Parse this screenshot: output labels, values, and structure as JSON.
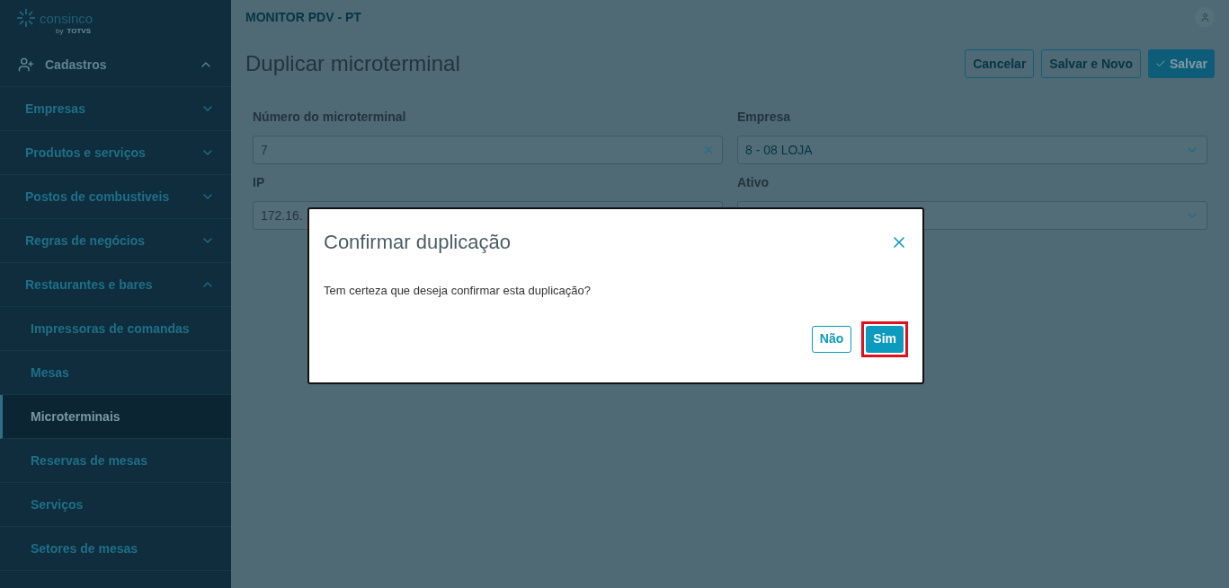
{
  "sidebar": {
    "logo": {
      "name": "consinco",
      "by": "by",
      "partner": "TOTVS"
    },
    "section": {
      "label": "Cadastros",
      "expanded": true
    },
    "items": [
      {
        "label": "Empresas",
        "expanded": false
      },
      {
        "label": "Produtos e serviços",
        "expanded": false
      },
      {
        "label": "Postos de combustiveis",
        "expanded": false
      },
      {
        "label": "Regras de negócios",
        "expanded": false
      },
      {
        "label": "Restaurantes e bares",
        "expanded": true,
        "children": [
          {
            "label": "Impressoras de comandas",
            "selected": false
          },
          {
            "label": "Mesas",
            "selected": false
          },
          {
            "label": "Microterminais",
            "selected": true
          },
          {
            "label": "Reservas de mesas",
            "selected": false
          },
          {
            "label": "Serviços",
            "selected": false
          },
          {
            "label": "Setores de mesas",
            "selected": false
          }
        ]
      }
    ]
  },
  "header": {
    "app_title": "MONITOR PDV - PT"
  },
  "page": {
    "title": "Duplicar microterminal",
    "actions": [
      {
        "label": "Cancelar",
        "kind": "outline"
      },
      {
        "label": "Salvar e Novo",
        "kind": "outline"
      },
      {
        "label": "Salvar",
        "kind": "primary"
      }
    ],
    "fields": [
      {
        "label": "Número do microterminal",
        "value": "7",
        "kind": "text",
        "clearable": true
      },
      {
        "label": "Empresa",
        "value": "8 - 08 LOJA",
        "kind": "select"
      },
      {
        "label": "IP",
        "value": "172.16.",
        "kind": "text"
      },
      {
        "label": "Ativo",
        "kind": "select"
      }
    ]
  },
  "dialog": {
    "title": "Confirmar duplicação",
    "message": "Tem certeza que deseja confirmar esta duplicação?",
    "buttons": [
      {
        "label": "Não",
        "kind": "outline",
        "highlighted": false
      },
      {
        "label": "Sim",
        "kind": "primary",
        "highlighted": true
      }
    ]
  }
}
